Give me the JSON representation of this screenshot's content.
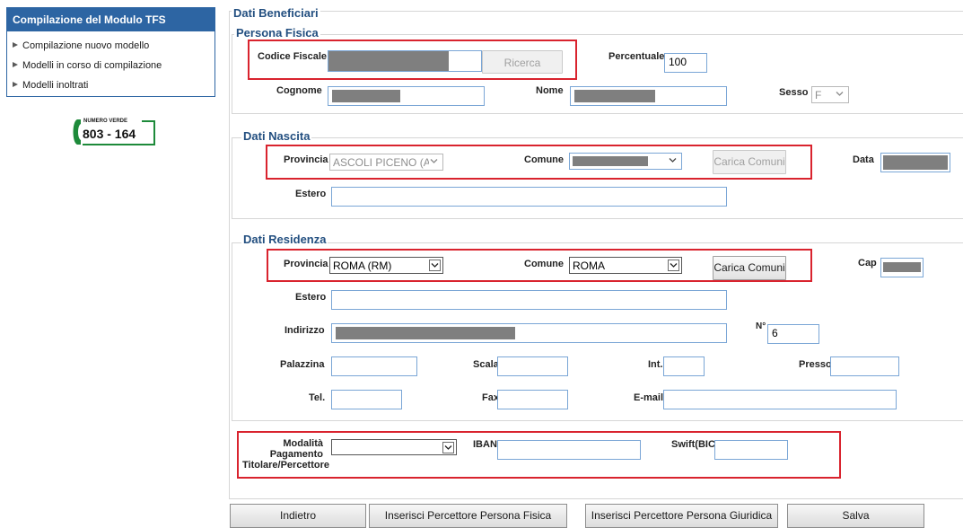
{
  "sidebar": {
    "title": "Compilazione del Modulo TFS",
    "items": [
      {
        "label": "Compilazione nuovo modello"
      },
      {
        "label": "Modelli in corso di compilazione"
      },
      {
        "label": "Modelli inoltrati"
      }
    ],
    "numero_verde": {
      "caption": "NUMERO VERDE",
      "number": "803 - 164"
    }
  },
  "form": {
    "section_beneficiari": "Dati Beneficiari",
    "persona_fisica": {
      "title": "Persona Fisica",
      "codice_fiscale_label": "Codice Fiscale",
      "ricerca_button": "Ricerca",
      "percentuale_label": "Percentuale",
      "percentuale_value": "100",
      "cognome_label": "Cognome",
      "nome_label": "Nome",
      "sesso_label": "Sesso",
      "sesso_value": "F"
    },
    "nascita": {
      "title": "Dati Nascita",
      "provincia_label": "Provincia",
      "provincia_value": "ASCOLI PICENO (AP",
      "comune_label": "Comune",
      "carica_comuni_button": "Carica Comuni",
      "data_label": "Data",
      "estero_label": "Estero"
    },
    "residenza": {
      "title": "Dati Residenza",
      "provincia_label": "Provincia",
      "provincia_value": "ROMA (RM)",
      "comune_label": "Comune",
      "comune_value": "ROMA",
      "carica_comuni_button": "Carica Comuni",
      "cap_label": "Cap",
      "estero_label": "Estero",
      "indirizzo_label": "Indirizzo",
      "numero_label": "N°",
      "numero_value": "6",
      "palazzina_label": "Palazzina",
      "scala_label": "Scala",
      "int_label": "Int.",
      "presso_label": "Presso",
      "tel_label": "Tel.",
      "fax_label": "Fax",
      "email_label": "E-mail"
    },
    "pagamento": {
      "modalita_label_1": "Modalità",
      "modalita_label_2": "Pagamento",
      "modalita_label_3": "Titolare/Percettore",
      "iban_label": "IBAN",
      "swift_label": "Swift(BIC)"
    }
  },
  "buttons": {
    "indietro": "Indietro",
    "percettore_fisica": "Inserisci Percettore Persona Fisica",
    "percettore_giuridica": "Inserisci Percettore Persona Giuridica",
    "salva": "Salva"
  },
  "colors": {
    "sidebar_header": "#2d65a3",
    "section_title": "#234f80",
    "highlight_red": "#d9232e",
    "input_border": "#7aa6d6"
  }
}
